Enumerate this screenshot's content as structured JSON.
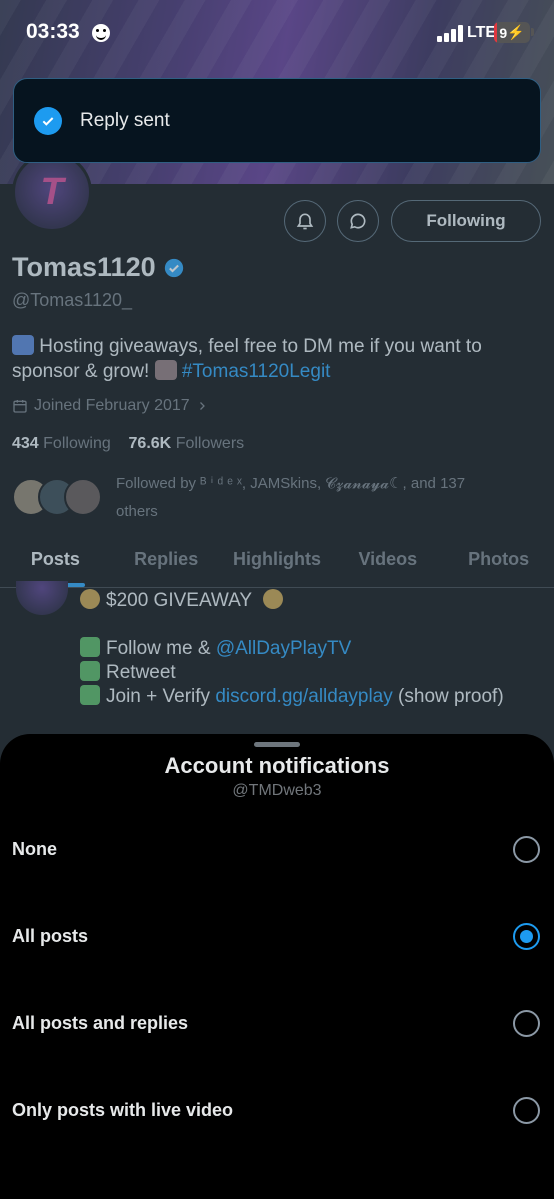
{
  "status_bar": {
    "time": "03:33",
    "network": "LTE",
    "battery": "9",
    "battery_level": 0.09
  },
  "toast": {
    "text": "Reply sent"
  },
  "profile": {
    "display_name": "Tomas1120",
    "handle": "@Tomas1120_",
    "following_button": "Following",
    "bio_line1": "Hosting giveaways, feel free to DM me if you want to",
    "bio_line2_prefix": "sponsor & grow!",
    "bio_hashtag": "#Tomas1120Legit",
    "joined": "Joined February 2017",
    "following_count": "434",
    "following_label": "Following",
    "followers_count": "76.6K",
    "followers_label": "Followers",
    "followed_by_line1": "Followed by ᴮ ⁱ ᵈ ᵉ ˣ, JAMSkins, 𝓒𝔃𝓪𝓷𝓪𝔂𝓪☾, and 137",
    "followed_by_line2": "others"
  },
  "tabs": [
    {
      "label": "Posts",
      "active": true
    },
    {
      "label": "Replies"
    },
    {
      "label": "Highlights"
    },
    {
      "label": "Videos"
    },
    {
      "label": "Photos"
    }
  ],
  "post": {
    "line1": "$200 GIVEAWAY",
    "line2_prefix": "Follow me &",
    "line2_link": "@AllDayPlayTV",
    "line3": "Retweet",
    "line4_prefix": "Join + Verify",
    "line4_link": "discord.gg/alldayplay",
    "line4_suffix": "(show proof)"
  },
  "sheet": {
    "title": "Account notifications",
    "subtitle": "@TMDweb3",
    "options": [
      {
        "label": "None",
        "selected": false
      },
      {
        "label": "All posts",
        "selected": true
      },
      {
        "label": "All posts and replies",
        "selected": false
      },
      {
        "label": "Only posts with live video",
        "selected": false
      }
    ]
  },
  "colors": {
    "accent": "#1d9bf0",
    "background": "#000000",
    "battery_low": "#e0373f"
  }
}
